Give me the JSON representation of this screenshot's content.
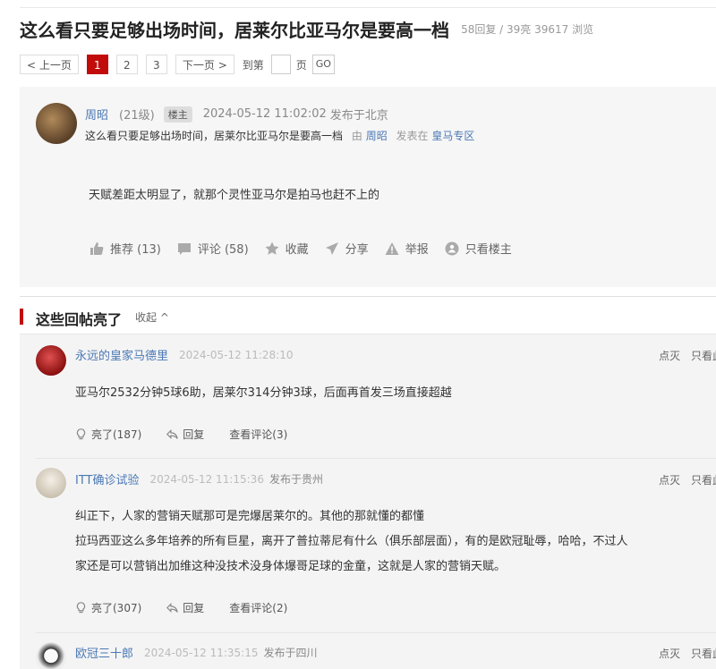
{
  "thread": {
    "title": "这么看只要足够出场时间，居莱尔比亚马尔是要高一档",
    "stats": "58回复 / 39亮 39617 浏览"
  },
  "pager": {
    "prev": "< 上一页",
    "pages": [
      "1",
      "2",
      "3"
    ],
    "current": "1",
    "next": "下一页 >",
    "goto_prefix": "到第",
    "goto_suffix": "页",
    "go": "GO"
  },
  "op": {
    "username": "周昭",
    "level": "(21级)",
    "badge": "楼主",
    "datetime": "2024-05-12 11:02:02",
    "location": "发布于北京",
    "subtitle": "这么看只要足够出场时间，居莱尔比亚马尔是要高一档",
    "by_text": "由",
    "by_user": "周昭",
    "posted_in": "发表在",
    "board": "皇马专区",
    "body": "天赋差距太明显了，就那个灵性亚马尔是拍马也赶不上的",
    "actions": {
      "recommend": "推荐 (13)",
      "comment": "评论 (58)",
      "favorite": "收藏",
      "share": "分享",
      "report": "举报",
      "only_op": "只看楼主"
    }
  },
  "hot_replies": {
    "title": "这些回帖亮了",
    "collapse": "收起 ^",
    "items": [
      {
        "username": "永远的皇家马德里",
        "datetime": "2024-05-12 11:28:10",
        "location": "",
        "dislike": "点灭",
        "only_see": "只看此",
        "lines": [
          "亚马尔2532分钟5球6助，居莱尔314分钟3球，后面再首发三场直接超越"
        ],
        "light": "亮了(187)",
        "reply": "回复",
        "view_comments": "查看评论(3)"
      },
      {
        "username": "ITT确诊试验",
        "datetime": "2024-05-12 11:15:36",
        "location": "发布于贵州",
        "dislike": "点灭",
        "only_see": "只看此",
        "lines": [
          "纠正下，人家的营销天赋那可是完爆居莱尔的。其他的那就懂的都懂",
          "拉玛西亚这么多年培养的所有巨星，离开了普拉蒂尼有什么（俱乐部层面），有的是欧冠耻辱，哈哈，不过人",
          "家还是可以营销出加维这种没技术没身体爆哥足球的金童，这就是人家的营销天赋。"
        ],
        "light": "亮了(307)",
        "reply": "回复",
        "view_comments": "查看评论(2)"
      },
      {
        "username": "欧冠三十郎",
        "datetime": "2024-05-12 11:35:15",
        "location": "发布于四川",
        "dislike": "点灭",
        "only_see": "只看此"
      }
    ]
  },
  "colors": {
    "accent": "#c20c0c",
    "link": "#4a78b5"
  }
}
